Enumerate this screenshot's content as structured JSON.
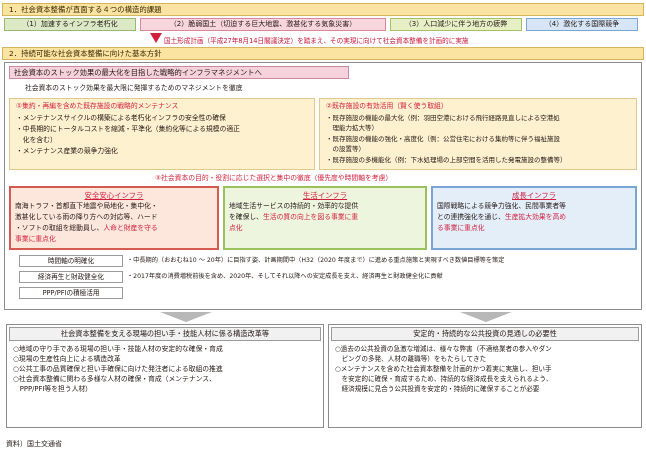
{
  "section1": {
    "label": "1．社会資本整備が直面する４つの構造的課題",
    "chips": [
      {
        "text": "（1）加速するインフラ老朽化",
        "bg": "#dbe9c6",
        "border": "#97bb6a"
      },
      {
        "text": "（2）脆弱国土（切迫する巨大地震、激甚化する気象災害）",
        "bg": "#f7d6de",
        "border": "#d9879b"
      },
      {
        "text": "（3）人口減少に伴う地方の疲弊",
        "bg": "#e6efc6",
        "border": "#a4c25f"
      },
      {
        "text": "（4）激化する国際競争",
        "bg": "#d6e6f6",
        "border": "#7aa6d4"
      }
    ],
    "note": "国土形成計画（平成27年8月14日閣議決定）を踏まえ、その実現に向けて社会資本整備を計画的に実施"
  },
  "section2": {
    "label": "2．持続可能な社会資本整備に向けた基本方針",
    "strategic_title": "社会資本のストック効果の最大化を目指した戦略的インフラマネジメントへ",
    "intro": "社会資本のストック効果を最大限に発揮するためのマネジメントを徹底",
    "box1": {
      "title": "①集約・再編を含めた既存施設の戦略的メンテナンス",
      "lines": [
        "・メンテナンスサイクルの構築による老朽化インフラの安全性の確保",
        "・中長期的にトータルコストを縮減・平準化（集約化等による規模の適正",
        "　化を含む）",
        "・メンテナンス産業の競争力強化"
      ]
    },
    "box2": {
      "title": "②既存施設の有効活用（賢く使う取組）",
      "lines": [
        "・既存施設の機能の最大化（例：羽田空港における飛行経路見直しによる空港処",
        "　理能力拡大等）",
        "・既存施設の機能の強化・高度化（例：公営住宅における集約等に伴う福祉施設",
        "　の設置等）",
        "・既存施設の多機能化（例：下水処理場の上部空間を活用した発電施設の整備等）"
      ]
    },
    "selection": "③社会資本の目的・役割に応じた選択と集中の徹底（優先度や時間軸を考慮）",
    "col1": {
      "title": "安全安心インフラ",
      "lines": [
        {
          "text": "南海トラフ・首都直下地震や局地化・集中化・",
          "red": false
        },
        {
          "text": "激甚化している雨の降り方への対応等、ハード",
          "red": false
        },
        {
          "text": "・ソフトの取組を総動員し、",
          "red": false,
          "tail": "人命と財産を守る"
        },
        {
          "text": "事業に重点化",
          "red": true
        }
      ]
    },
    "col2": {
      "title": "生活インフラ",
      "lines": [
        {
          "text": "地域生活サービスの持続的・効率的な提供",
          "red": false
        },
        {
          "text": "を確保し、",
          "red": false,
          "tail": "生活の質の向上を図る事業に重"
        },
        {
          "text": "点化",
          "red": true
        }
      ]
    },
    "col3": {
      "title": "成長インフラ",
      "lines": [
        {
          "text": "国際戦略による競争力強化、民間事業者等",
          "red": false
        },
        {
          "text": "との連携強化を通じ、",
          "red": false,
          "tail": "生産拡大効果を高め"
        },
        {
          "text": "る事業に重点化",
          "red": true
        }
      ]
    },
    "rows": [
      {
        "label": "時間軸の明確化",
        "text": "・中長期的（おおむね10 〜 20年）に目指す姿、計画期間中（H32（2020 年度まで）に進める重点施策と実現すべき数値目標等を策定"
      },
      {
        "label": "経済再生と財政健全化",
        "text": "・2017年度の消費増税前後を含め、2020年、そしてそれ以降への安定成長を支え、経済再生と財政健全化に貢献"
      },
      {
        "label": "PPP/PFIの積極活用",
        "text": ""
      }
    ]
  },
  "bottom": {
    "left": {
      "title": "社会資本整備を支える現場の担い手・技能人材に係る構造改革等",
      "lines": [
        "○地域の守り手である現場の担い手・技能人材の安定的な確保・育成",
        "○現場の生産性向上による構造改革",
        "○公共工事の品質確保と担い手確保に向けた発注者による取組の推進",
        "○社会資本整備に関わる多様な人材の確保・育成（メンテナンス、",
        "　PPP/PFI等を担う人材）"
      ]
    },
    "right": {
      "title": "安定的・持続的な公共投資の見通しの必要性",
      "lines": [
        "○過去の公共投資の急激な増減は、様々な弊害（不適格業者の参入やダン",
        "　ピングの多発、人材の離職等）をもたらしてきた",
        "○メンテナンスを含めた社会資本整備を計画的かつ着実に実施し、担い手",
        "　を安定的に確保・育成するため、持続的な経済成長を支えられるよう、",
        "　経済規模に見合う公共投資を安定的・持続的に確保することが必要"
      ]
    }
  },
  "source": "資料）国土交通省"
}
